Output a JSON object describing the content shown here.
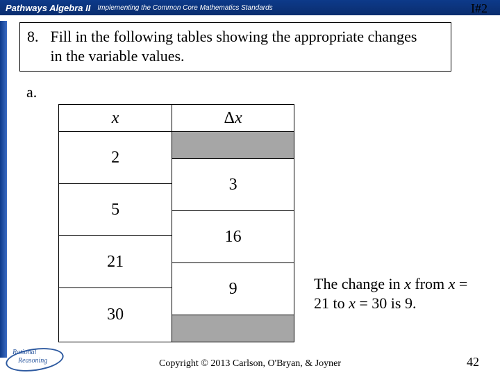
{
  "header": {
    "brand": "Pathways Algebra II",
    "subtitle": "Implementing the Common Core Mathematics Standards"
  },
  "tag": "I#2",
  "question": {
    "number": "8.",
    "text": "Fill in the following tables showing the appropriate changes in the variable values."
  },
  "part_label": "a.",
  "table": {
    "col_x": "x",
    "col_dx": "Δx",
    "x_vals": [
      "2",
      "5",
      "21",
      "30"
    ],
    "dx_vals": [
      "3",
      "16",
      "9"
    ]
  },
  "note_text": "The change in x from x = 21 to x = 30 is 9.",
  "footer": "Copyright © 2013 Carlson, O'Bryan, & Joyner",
  "page_num": "42",
  "logo": {
    "line1": "Rational",
    "line2": "Reasoning"
  }
}
